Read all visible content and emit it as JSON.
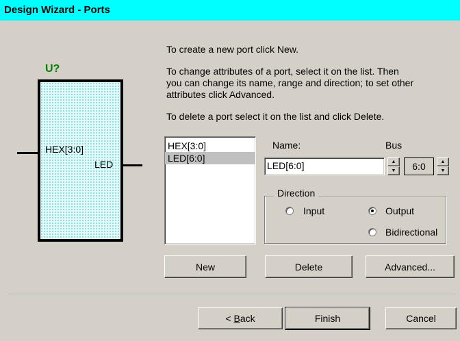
{
  "window": {
    "title": "Design Wizard - Ports"
  },
  "instructions": {
    "line1": "To create a new port click New.",
    "line2a": "To change attributes of a port, select it on the list. Then",
    "line2b": "you can change its name, range and direction; to set other",
    "line2c": "attributes click Advanced.",
    "line3": "To delete a port select it on the list and click Delete."
  },
  "symbol": {
    "ref": "U?",
    "input_pin": "HEX[3:0]",
    "output_pin": "LED"
  },
  "ports": [
    {
      "label": "HEX[3:0]",
      "selected": false
    },
    {
      "label": "LED[6:0]",
      "selected": true
    }
  ],
  "fields": {
    "name_label": "Name:",
    "name_value": "LED[6:0]",
    "bus_label": "Bus",
    "bus_value": "6:0"
  },
  "direction": {
    "legend": "Direction",
    "input": "Input",
    "output": "Output",
    "bidirectional": "Bidirectional",
    "selected": "Output"
  },
  "buttons": {
    "new": "New",
    "delete": "Delete",
    "advanced": "Advanced...",
    "back_prefix": "< ",
    "back_accel": "B",
    "back_rest": "ack",
    "finish": "Finish",
    "cancel": "Cancel"
  },
  "colors": {
    "titlebar": "#00ffff",
    "symbol_fill": "#e0fafa",
    "ref_label": "#008000"
  }
}
